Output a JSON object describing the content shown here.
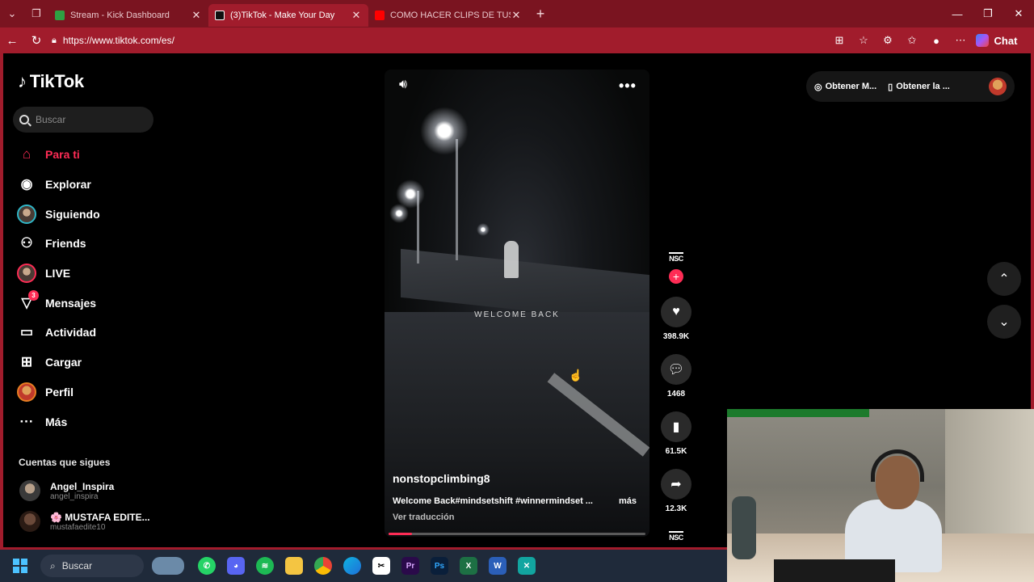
{
  "browser": {
    "tabs": [
      {
        "title": "Stream - Kick Dashboard",
        "active": false,
        "favicon_color": "#53fc18"
      },
      {
        "title": "(3)TikTok - Make Your Day",
        "active": true,
        "favicon_color": "#000000"
      },
      {
        "title": "COMO HACER CLIPS DE TUS STRE",
        "active": false,
        "favicon_color": "#ff0000"
      }
    ],
    "url": "https://www.tiktok.com/es/",
    "chat_label": "Chat"
  },
  "tiktok": {
    "logo": "TikTok",
    "search_placeholder": "Buscar",
    "menu": [
      {
        "label": "Para ti",
        "icon": "home-icon",
        "active": true
      },
      {
        "label": "Explorar",
        "icon": "compass-icon"
      },
      {
        "label": "Siguiendo",
        "icon": "avatar-icon"
      },
      {
        "label": "Friends",
        "icon": "friends-icon"
      },
      {
        "label": "LIVE",
        "icon": "live-avatar-icon"
      },
      {
        "label": "Mensajes",
        "icon": "send-icon",
        "badge": "3"
      },
      {
        "label": "Actividad",
        "icon": "inbox-icon"
      },
      {
        "label": "Cargar",
        "icon": "upload-icon"
      },
      {
        "label": "Perfil",
        "icon": "profile-avatar-icon"
      },
      {
        "label": "Más",
        "icon": "dots-icon"
      }
    ],
    "following_title": "Cuentas que sigues",
    "following": [
      {
        "name": "Angel_Inspira",
        "handle": "angel_inspira"
      },
      {
        "name": "🌸 MUSTAFA EDITE...",
        "handle": "mustafaedite10"
      }
    ],
    "chips": [
      "Obtener M...",
      "Obtener la ..."
    ],
    "video": {
      "overlay_text": "WELCOME BACK",
      "username": "nonstopclimbing8",
      "description": "Welcome Back#mindsetshift #winnermindset ...",
      "more": "más",
      "translate": "Ver traducción",
      "progress": 0.09
    },
    "actions": {
      "brand": "NSC",
      "likes": "398.9K",
      "comments": "1468",
      "saves": "61.5K",
      "shares": "12.3K"
    }
  },
  "taskbar": {
    "search_label": "Buscar",
    "apps": [
      "whatsapp-icon",
      "discord-icon",
      "spotify-icon",
      "file-explorer-icon",
      "chrome-icon",
      "edge-icon",
      "capcut-icon",
      "premiere-icon",
      "photoshop-icon",
      "excel-icon",
      "word-icon",
      "app-x-icon"
    ]
  },
  "colors": {
    "browser_frame": "#a11c2c",
    "tiktok_accent": "#fe2c55"
  }
}
